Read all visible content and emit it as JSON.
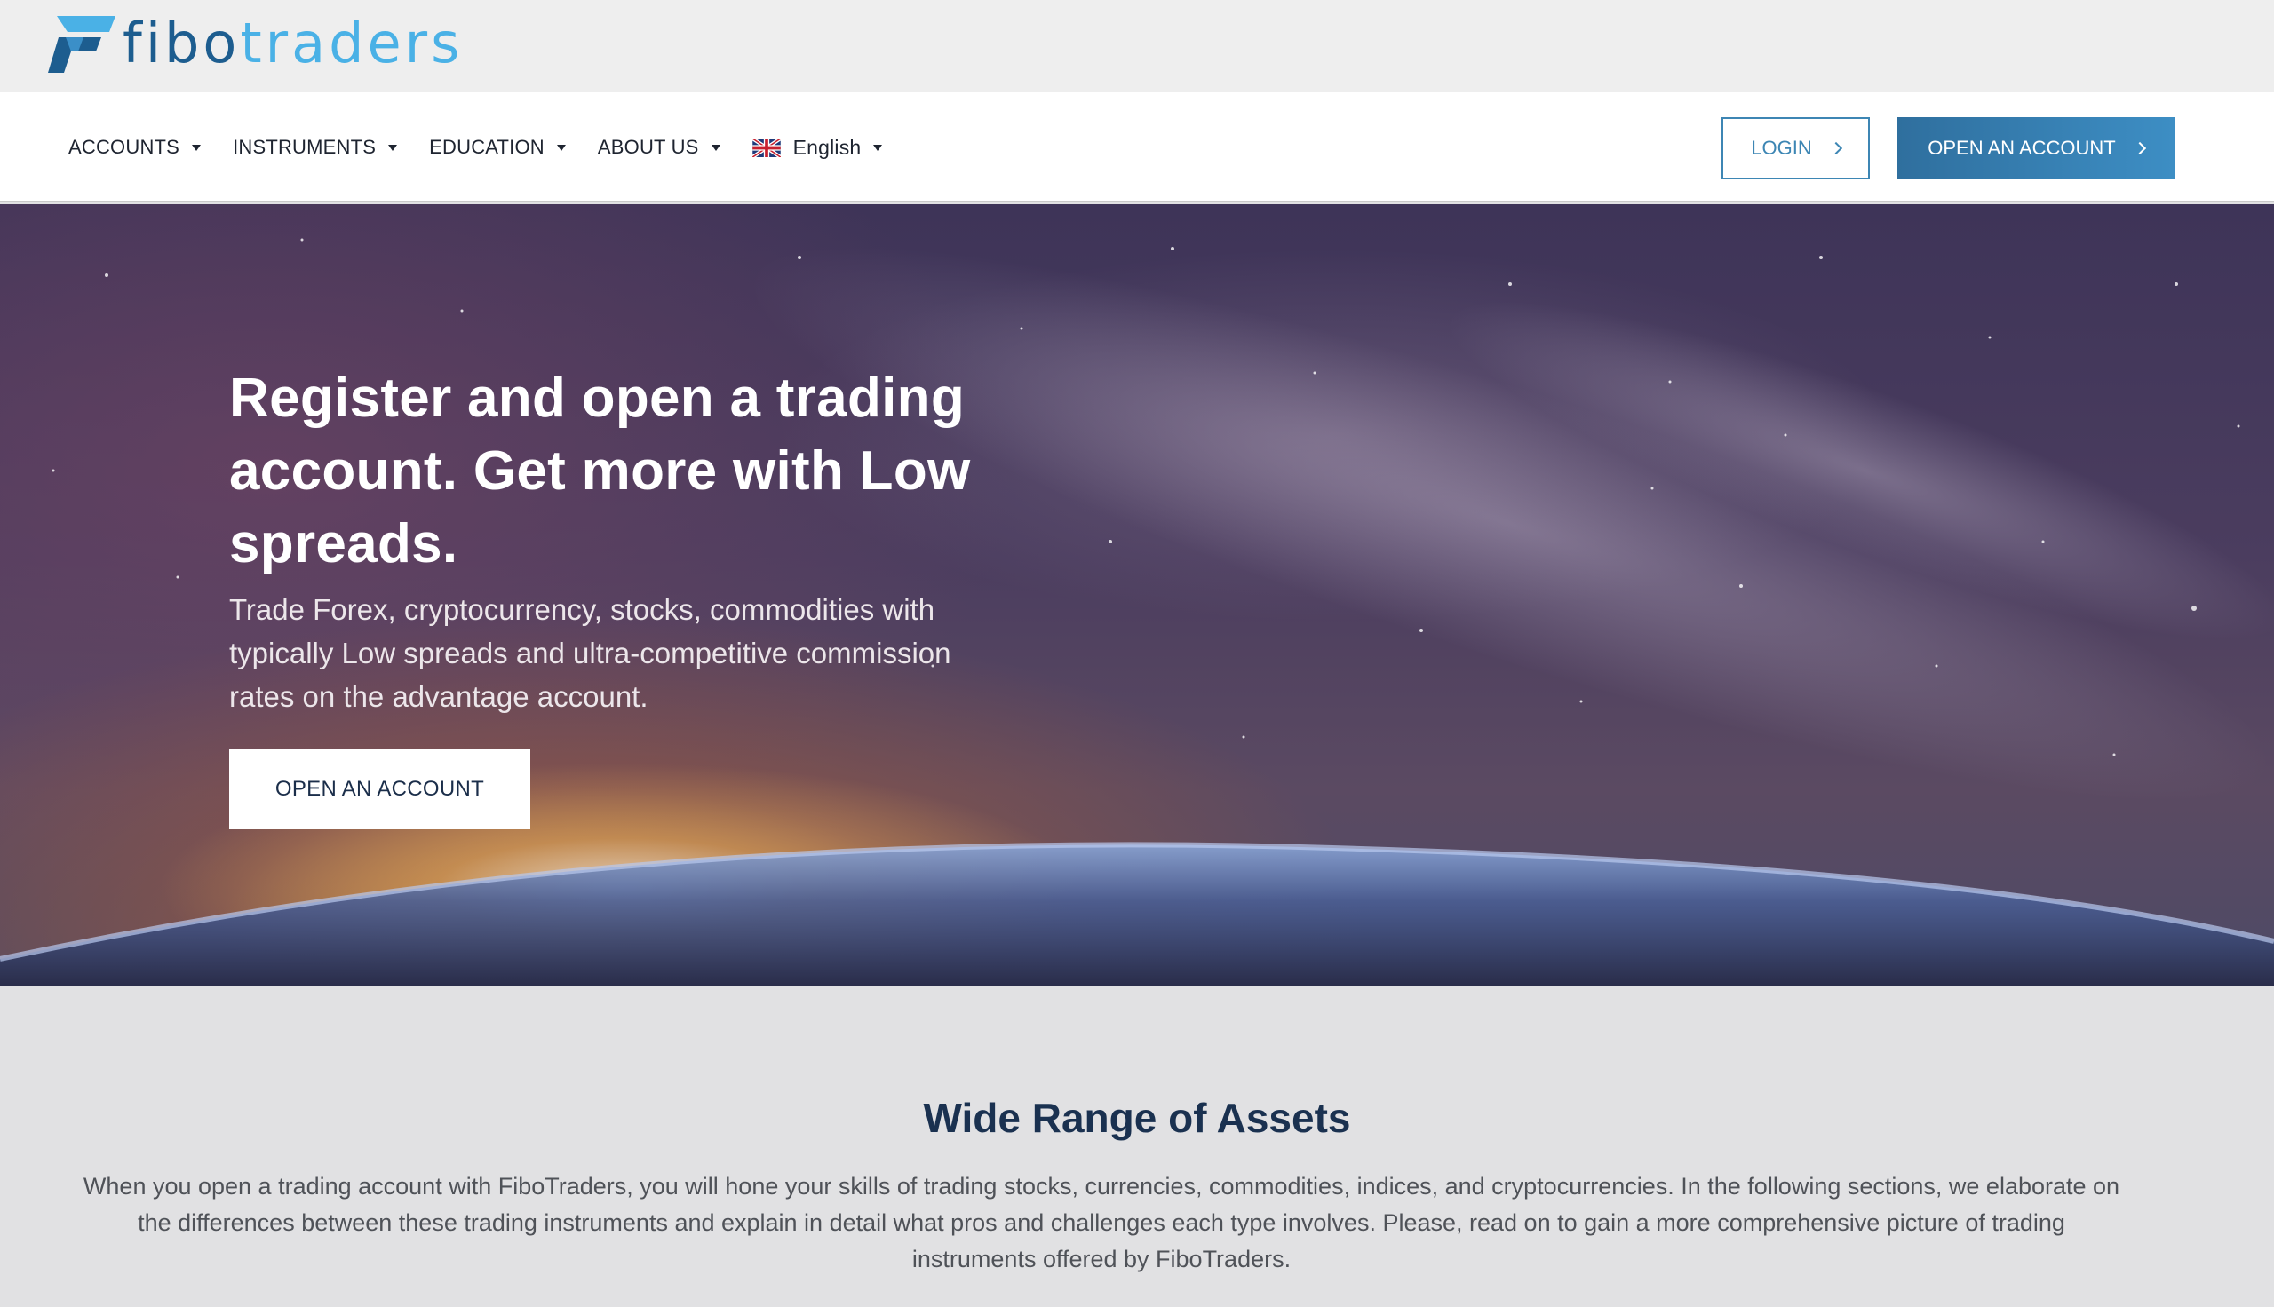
{
  "brand": {
    "name_part1": "fibo",
    "name_part2": "traders",
    "colors": {
      "dark_blue": "#1d5d8f",
      "light_blue": "#4ab1e6"
    }
  },
  "nav": {
    "items": [
      {
        "label": "ACCOUNTS"
      },
      {
        "label": "INSTRUMENTS"
      },
      {
        "label": "EDUCATION"
      },
      {
        "label": "ABOUT US"
      }
    ],
    "language": {
      "label": "English",
      "flag_icon": "uk-flag-icon"
    },
    "login_label": "LOGIN",
    "open_account_label": "OPEN AN ACCOUNT"
  },
  "hero": {
    "title": "Register and open a trading account. Get more with Low spreads.",
    "subtitle": "Trade Forex, cryptocurrency, stocks, commodities with typically Low spreads and ultra-competitive commission rates on the advantage account.",
    "cta_label": "OPEN AN ACCOUNT"
  },
  "assets": {
    "title": "Wide Range of Assets",
    "body": "When you open a trading account with FiboTraders, you will hone your skills of trading stocks, currencies, commodities, indices, and cryptocurrencies. In the following sections, we elaborate on the differences between these trading instruments and explain in detail what pros and challenges each type involves. Please, read on to gain a more comprehensive picture of trading instruments offered by FiboTraders."
  }
}
